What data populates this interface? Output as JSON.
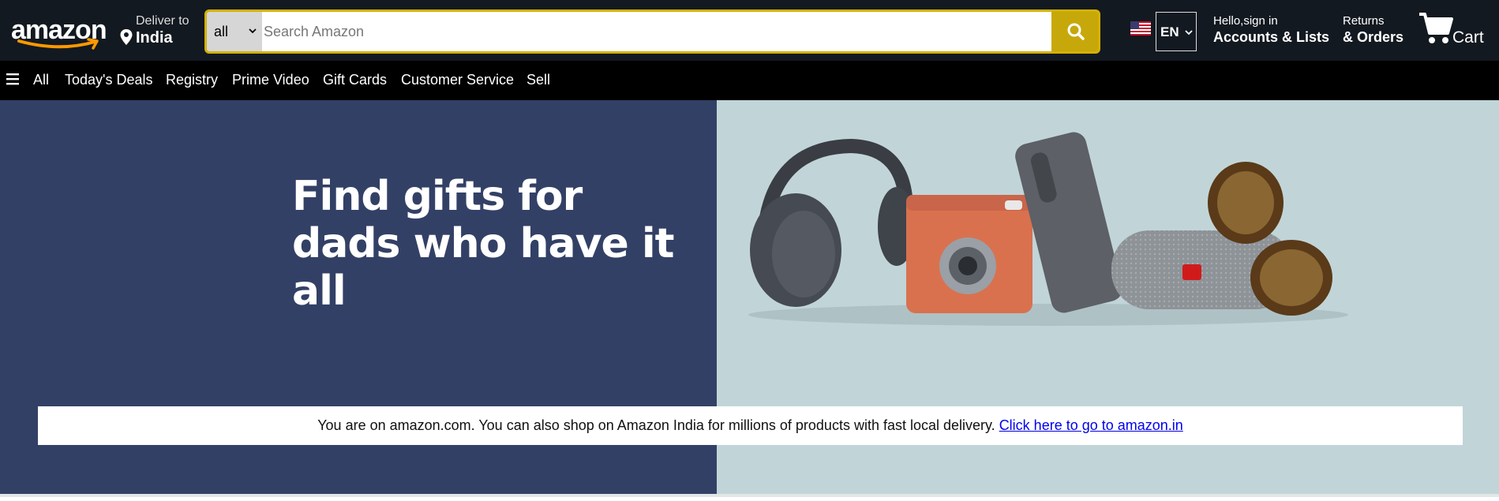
{
  "header": {
    "logo_text": "amazon",
    "deliver_line1": "Deliver to",
    "deliver_line2": "India",
    "search": {
      "category": "all",
      "placeholder": "Search Amazon"
    },
    "language": "EN",
    "account_line1": "Hello,sign in",
    "account_line2": "Accounts & Lists",
    "orders_line1": "Returns",
    "orders_line2": "& Orders",
    "cart_label": "Cart"
  },
  "nav": {
    "items": [
      "All",
      "Today's Deals",
      "Registry",
      "Prime Video",
      "Gift Cards",
      "Customer Service",
      "Sell"
    ]
  },
  "hero": {
    "title_line1": "Find gifts for",
    "title_line2": "dads who have it all"
  },
  "notice": {
    "text": "You are on amazon.com. You can also shop on Amazon India for millions of products with fast local delivery. ",
    "link": "Click here to go to amazon.in"
  },
  "colors": {
    "topbar": "#131921",
    "search_button": "#c7a80a",
    "hero_left": "#334066",
    "hero_right": "#c1d5d8",
    "link": "#0000ee"
  },
  "icons": [
    "amazon-smile-logo",
    "location-pin-icon",
    "chevron-down-icon",
    "search-icon",
    "us-flag-icon",
    "cart-icon",
    "hamburger-menu-icon"
  ]
}
